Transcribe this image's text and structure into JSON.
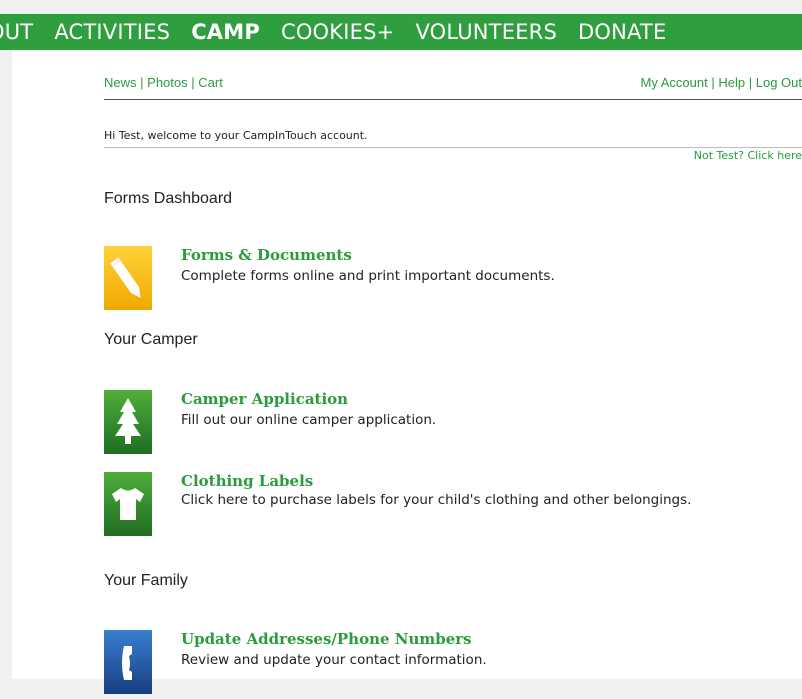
{
  "topnav": {
    "items": [
      "OUT",
      "ACTIVITIES",
      "CAMP",
      "COOKIES+",
      "VOLUNTEERS",
      "DONATE"
    ],
    "active": "CAMP",
    "color": "#2e9e3e"
  },
  "util": {
    "news": "News",
    "photos": "Photos",
    "cart": "Cart",
    "my_account": "My Account",
    "help": "Help",
    "log_out": "Log Out",
    "sep": "|"
  },
  "welcome": {
    "text": "Hi Test, welcome to your CampInTouch account.",
    "not_you": "Not Test? Click here"
  },
  "sections": {
    "forms_dashboard": "Forms Dashboard",
    "your_camper": "Your Camper",
    "your_family": "Your Family"
  },
  "tiles": {
    "forms": {
      "title": "Forms & Documents",
      "desc": "Complete forms online and print important documents.",
      "icon": "pencil-icon",
      "color": "#f5b800"
    },
    "camper_app": {
      "title": "Camper Application",
      "desc": "Fill out our online camper application.",
      "icon": "tree-icon",
      "color": "#2f8a2f"
    },
    "clothing": {
      "title": "Clothing Labels",
      "desc": "Click here to purchase labels for your child's clothing and other belongings.",
      "icon": "tshirt-icon",
      "color": "#2f8a2f"
    },
    "addresses": {
      "title": "Update Addresses/Phone Numbers",
      "desc": "Review and update your contact information.",
      "icon": "phone-icon",
      "color": "#1f5fa8"
    }
  }
}
